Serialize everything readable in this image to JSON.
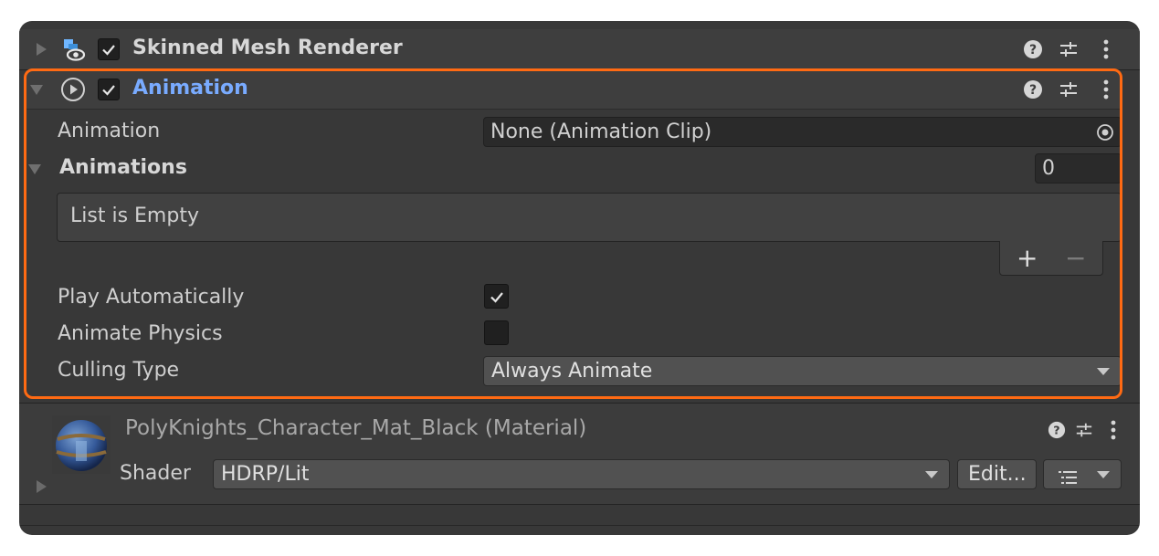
{
  "skinned_mesh_renderer": {
    "title": "Skinned Mesh Renderer",
    "enabled": true,
    "icons": [
      "skinned-mesh-icon",
      "help-icon",
      "preset-icon",
      "kebab-menu-icon"
    ]
  },
  "animation_component": {
    "title": "Animation",
    "enabled": true,
    "highlight_color": "#ff6a13",
    "title_color": "#79abff",
    "fields": {
      "animation_label": "Animation",
      "animation_value": "None (Animation Clip)",
      "animations_label": "Animations",
      "animations_count": "0",
      "list_empty_text": "List is Empty",
      "add_symbol": "+",
      "remove_symbol": "−",
      "play_automatically_label": "Play Automatically",
      "play_automatically": true,
      "animate_physics_label": "Animate Physics",
      "animate_physics": false,
      "culling_type_label": "Culling Type",
      "culling_type_value": "Always Animate"
    }
  },
  "material": {
    "title": "PolyKnights_Character_Mat_Black (Material)",
    "shader_label": "Shader",
    "shader_value": "HDRP/Lit",
    "edit_button": "Edit..."
  }
}
